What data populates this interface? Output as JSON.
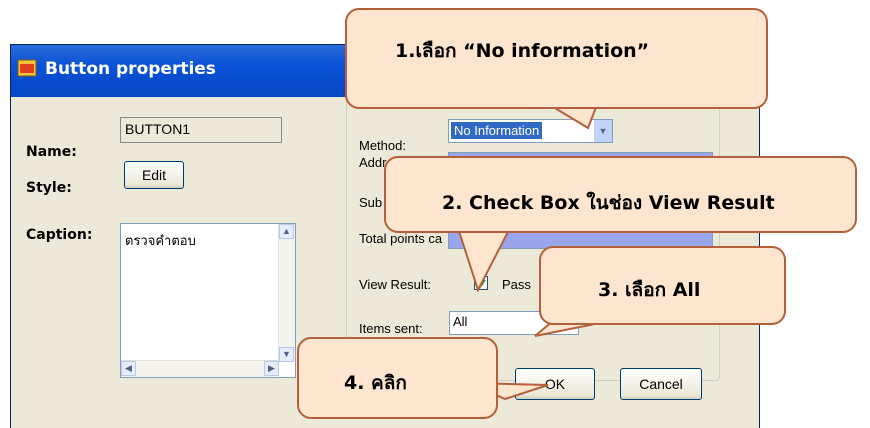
{
  "window": {
    "title": "Button properties"
  },
  "form": {
    "name_label": "Name:",
    "name_value": "BUTTON1",
    "style_label": "Style:",
    "edit_button": "Edit",
    "caption_label": "Caption:",
    "caption_value": "ตรวจคำตอบ"
  },
  "right_panel": {
    "method_label": "Method:",
    "method_value": "No Information",
    "address_label": "Address:",
    "sub_label": "Sub",
    "total_label": "Total points ca",
    "view_result_label": "View Result:",
    "view_result_checked": true,
    "pass_label": "Pass",
    "items_sent_label": "Items sent:",
    "items_sent_value": "All"
  },
  "buttons": {
    "ok": "OK",
    "cancel": "Cancel"
  },
  "callouts": {
    "step1": "1.เลือก “No information”",
    "step2": "2. Check Box ในช่อง View Result",
    "step3": "3. เลือก All",
    "step4": "4. คลิก"
  },
  "colors": {
    "titlebar": "#0a52d6",
    "callout_fill": "#fde5cf",
    "callout_border": "#b4603a",
    "dialog_bg": "#ece9d8"
  }
}
